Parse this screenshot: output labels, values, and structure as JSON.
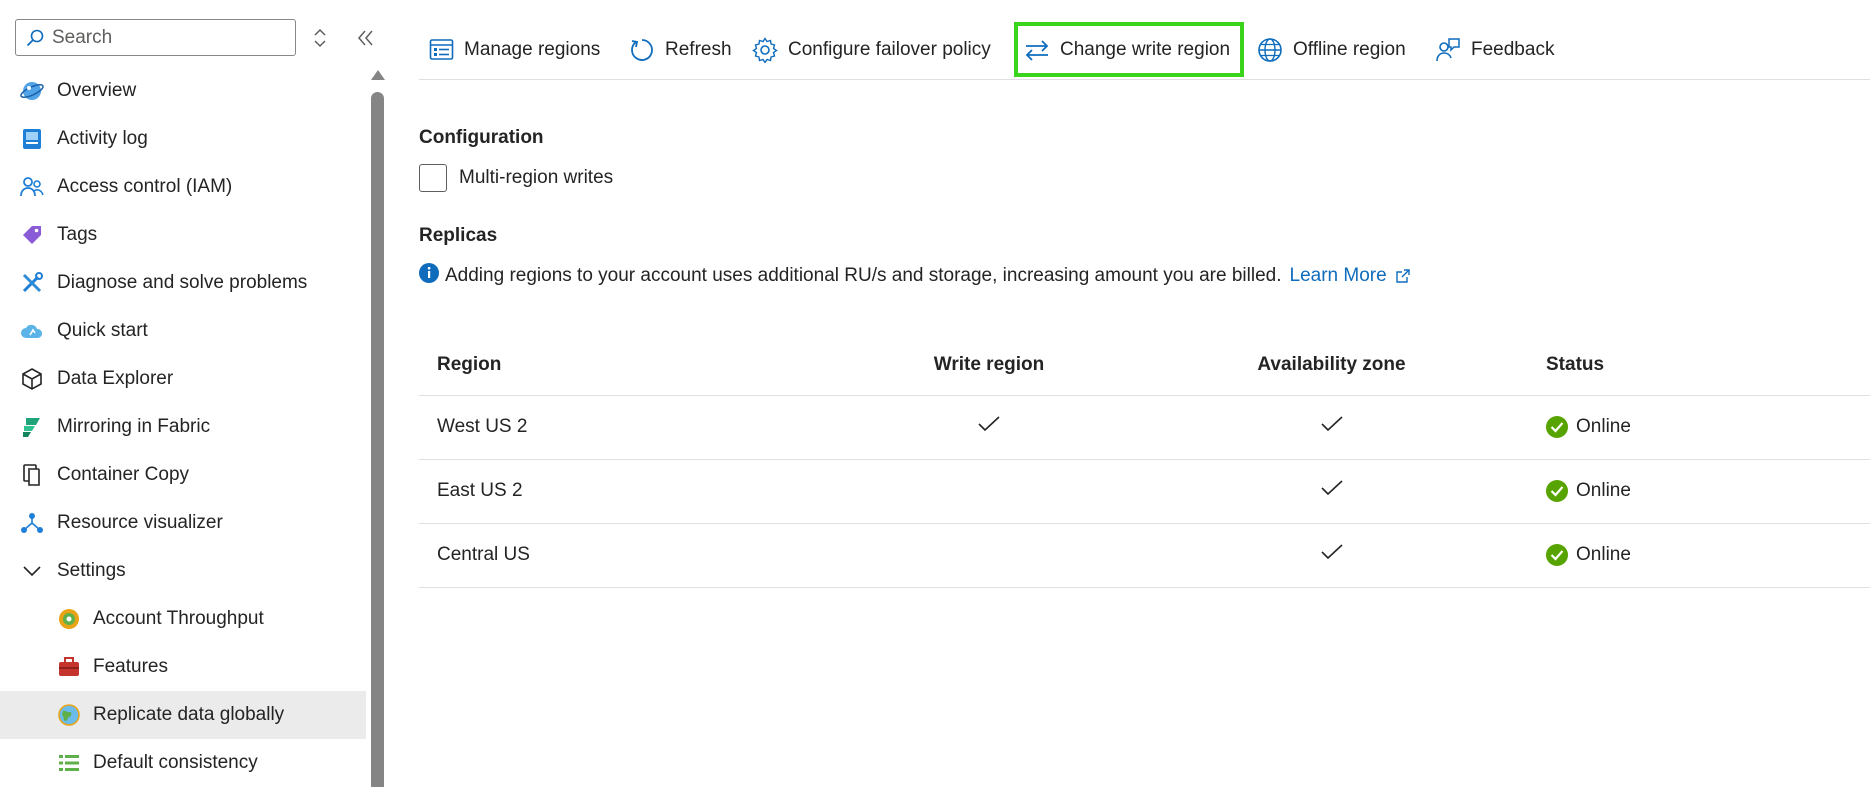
{
  "search": {
    "placeholder": "Search"
  },
  "sidebar": {
    "items": [
      {
        "label": "Overview",
        "icon": "cosmos-globe-icon"
      },
      {
        "label": "Activity log",
        "icon": "activity-log-icon"
      },
      {
        "label": "Access control (IAM)",
        "icon": "people-icon"
      },
      {
        "label": "Tags",
        "icon": "tag-icon"
      },
      {
        "label": "Diagnose and solve problems",
        "icon": "wrench-icon"
      },
      {
        "label": "Quick start",
        "icon": "cloud-icon"
      },
      {
        "label": "Data Explorer",
        "icon": "cube-icon"
      },
      {
        "label": "Mirroring in Fabric",
        "icon": "fabric-icon"
      },
      {
        "label": "Container Copy",
        "icon": "copy-icon"
      },
      {
        "label": "Resource visualizer",
        "icon": "network-icon"
      },
      {
        "label": "Settings",
        "icon": "chevron-down-icon"
      },
      {
        "label": "Account Throughput",
        "icon": "throughput-icon"
      },
      {
        "label": "Features",
        "icon": "briefcase-icon"
      },
      {
        "label": "Replicate data globally",
        "icon": "globe-icon"
      },
      {
        "label": "Default consistency",
        "icon": "list-lines-icon"
      }
    ]
  },
  "toolbar": {
    "manage_regions": "Manage regions",
    "refresh": "Refresh",
    "configure_failover": "Configure failover policy",
    "change_write_region": "Change write region",
    "offline_region": "Offline region",
    "feedback": "Feedback"
  },
  "main": {
    "configuration_title": "Configuration",
    "multi_region_writes": "Multi-region writes",
    "replicas_title": "Replicas",
    "info_text": "Adding regions to your account uses additional RU/s and storage, increasing amount you are billed.",
    "learn_more": "Learn More"
  },
  "table": {
    "headers": {
      "region": "Region",
      "write_region": "Write region",
      "availability_zone": "Availability zone",
      "status": "Status"
    },
    "rows": [
      {
        "region": "West US 2",
        "write_region": true,
        "availability_zone": true,
        "status": "Online"
      },
      {
        "region": "East US 2",
        "write_region": false,
        "availability_zone": true,
        "status": "Online"
      },
      {
        "region": "Central US",
        "write_region": false,
        "availability_zone": true,
        "status": "Online"
      }
    ]
  },
  "colors": {
    "accent": "#0f6cbd",
    "highlight": "#3bd41c",
    "online": "#57a300",
    "active_bg": "#ebebeb"
  }
}
